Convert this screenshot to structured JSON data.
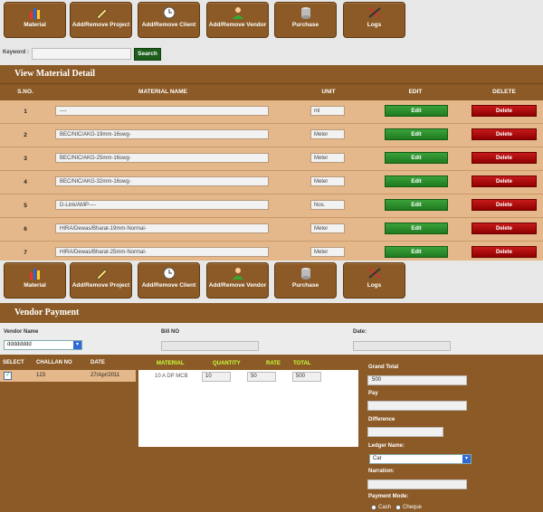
{
  "nav": [
    {
      "label": "Material",
      "icon": "bar-chart-icon"
    },
    {
      "label": "Add/Remove Project",
      "icon": "pencil-icon"
    },
    {
      "label": "Add/Remove Client",
      "icon": "clock-icon"
    },
    {
      "label": "Add/Remove Vendor",
      "icon": "user-icon"
    },
    {
      "label": "Purchase",
      "icon": "database-icon"
    },
    {
      "label": "Logs",
      "icon": "tools-icon"
    }
  ],
  "search": {
    "keyword_label": "Keyword :",
    "keyword_value": "",
    "button": "Search"
  },
  "material_detail": {
    "title": "View Material Detail",
    "headers": {
      "sno": "S.NO.",
      "name": "MATERIAL NAME",
      "unit": "UNIT",
      "edit": "EDIT",
      "delete": "DELETE"
    },
    "rows": [
      {
        "sno": "1",
        "name": "----",
        "unit": "ml"
      },
      {
        "sno": "2",
        "name": "BEC/NIC/AKG-19mm-16swg-",
        "unit": "Meter"
      },
      {
        "sno": "3",
        "name": "BEC/NIC/AKG-25mm-16swg-",
        "unit": "Meter"
      },
      {
        "sno": "4",
        "name": "BEC/NIC/AKG-32mm-16swg-",
        "unit": "Meter"
      },
      {
        "sno": "5",
        "name": "D-Link/AMP----",
        "unit": "Nos."
      },
      {
        "sno": "6",
        "name": "HIRA/Dewas/Bharat-19mm-Normal-",
        "unit": "Meter"
      },
      {
        "sno": "7",
        "name": "HIRA/Dewas/Bharat-25mm-Normal-",
        "unit": "Meter"
      }
    ],
    "edit_label": "Edit",
    "delete_label": "Delete"
  },
  "vendor_payment": {
    "title": "Vendor Payment",
    "vendor_name_label": "Vendor Name",
    "vendor_name_value": "dddddddd",
    "bill_no_label": "Bill NO",
    "date_label": "Date:",
    "challan": {
      "headers": {
        "select": "SELECT",
        "challan_no": "CHALLAN NO",
        "date": "DATE"
      },
      "rows": [
        {
          "checked": "✓",
          "challan_no": "123",
          "date": "27/Apr/2011"
        }
      ]
    },
    "materials": {
      "headers": {
        "material": "MATERIAL",
        "quantity": "QUANTITY",
        "rate": "RATE",
        "total": "TOTAL"
      },
      "rows": [
        {
          "material": "10 A DP MCB",
          "quantity": "10",
          "rate": "50",
          "total": "500"
        }
      ]
    },
    "grand_total_label": "Grand Total",
    "grand_total_value": "500",
    "pay_label": "Pay",
    "difference_label": "Difference",
    "ledger_label": "Ledger Name:",
    "ledger_value": "Car",
    "narration_label": "Narration:",
    "payment_mode_label": "Payment Mode:",
    "payment_modes": [
      "Cash",
      "Cheque"
    ]
  },
  "colors": {
    "brand_brown": "#8b5a26",
    "row_tan": "#e4b88a",
    "edit_green": "#2a8f2a",
    "delete_red": "#b10c0c",
    "accent_lime": "#c8ff3a"
  }
}
